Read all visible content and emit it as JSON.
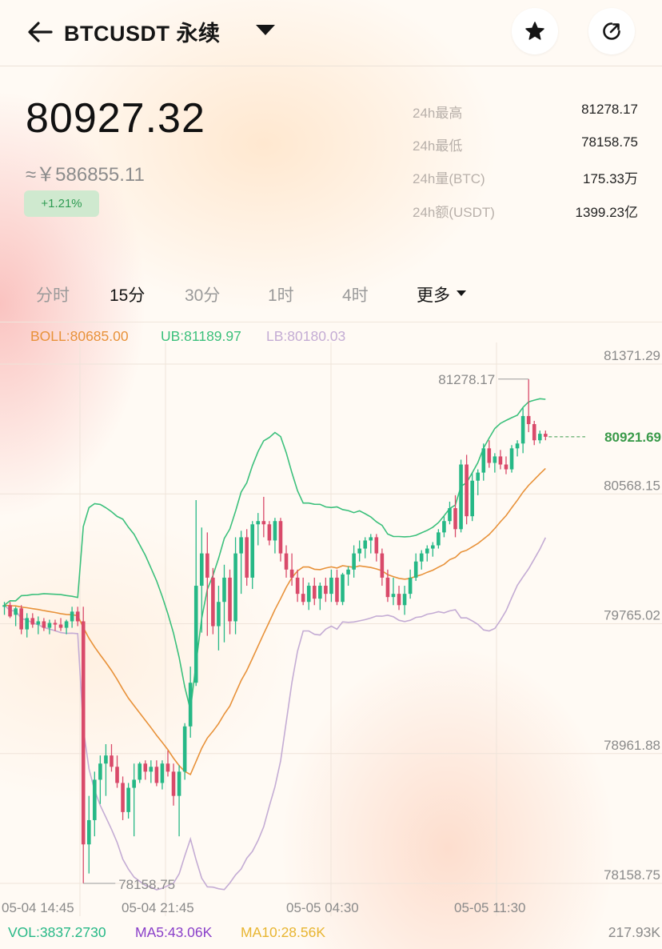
{
  "header": {
    "title": "BTCUSDT 永续",
    "icons": [
      "back-arrow-icon",
      "dropdown-caret-icon",
      "star-icon",
      "share-icon"
    ]
  },
  "ticker": {
    "last_price": "80927.32",
    "cny_price": "≈￥586855.11",
    "change_pct": "+1.21%"
  },
  "stats": [
    {
      "label": "24h最高",
      "value": "81278.17"
    },
    {
      "label": "24h最低",
      "value": "78158.75"
    },
    {
      "label": "24h量(BTC)",
      "value": "175.33万"
    },
    {
      "label": "24h额(USDT)",
      "value": "1399.23亿"
    }
  ],
  "tabs": [
    {
      "label": "分时",
      "active": false
    },
    {
      "label": "15分",
      "active": true
    },
    {
      "label": "30分",
      "active": false
    },
    {
      "label": "1时",
      "active": false
    },
    {
      "label": "4时",
      "active": false
    },
    {
      "label": "更多",
      "active": false
    }
  ],
  "boll": {
    "boll_label": "BOLL:80685.00",
    "ub_label": "UB:81189.97",
    "lb_label": "LB:80180.03"
  },
  "colors": {
    "up": "#26b886",
    "down": "#d94a6a",
    "boll": "#e8923a",
    "ub": "#3cc07c",
    "lb": "#c4acd4",
    "ma5": "#8a3fc9",
    "ma10": "#e8b530",
    "current_price": "#3a9a4a"
  },
  "chart_data": {
    "type": "candlestick",
    "interval": "15分",
    "y_axis_ticks": [
      "81371.29",
      "80568.15",
      "79765.02",
      "78961.88",
      "78158.75"
    ],
    "ylim": [
      78158.75,
      81371.29
    ],
    "x_axis_ticks": [
      "05-04 14:45",
      "05-04 21:45",
      "05-05 04:30",
      "05-05 11:30"
    ],
    "current_price_label": "80921.69",
    "high_marker": "81278.17",
    "low_marker": "78158.75",
    "candles": [
      {
        "o": 79870,
        "h": 79900,
        "l": 79820,
        "c": 79880
      },
      {
        "o": 79880,
        "h": 79900,
        "l": 79800,
        "c": 79810
      },
      {
        "o": 79820,
        "h": 79870,
        "l": 79750,
        "c": 79860
      },
      {
        "o": 79860,
        "h": 79880,
        "l": 79700,
        "c": 79730
      },
      {
        "o": 79730,
        "h": 79830,
        "l": 79680,
        "c": 79800
      },
      {
        "o": 79800,
        "h": 79830,
        "l": 79740,
        "c": 79760
      },
      {
        "o": 79760,
        "h": 79810,
        "l": 79700,
        "c": 79780
      },
      {
        "o": 79780,
        "h": 79800,
        "l": 79720,
        "c": 79740
      },
      {
        "o": 79740,
        "h": 79790,
        "l": 79700,
        "c": 79770
      },
      {
        "o": 79770,
        "h": 79790,
        "l": 79720,
        "c": 79760
      },
      {
        "o": 79760,
        "h": 79800,
        "l": 79720,
        "c": 79740
      },
      {
        "o": 79740,
        "h": 79790,
        "l": 79700,
        "c": 79780
      },
      {
        "o": 79780,
        "h": 79870,
        "l": 79740,
        "c": 79840
      },
      {
        "o": 79840,
        "h": 79870,
        "l": 79750,
        "c": 79780
      },
      {
        "o": 79780,
        "h": 79870,
        "l": 78160,
        "c": 78400
      },
      {
        "o": 78400,
        "h": 78700,
        "l": 78220,
        "c": 78550
      },
      {
        "o": 78550,
        "h": 78850,
        "l": 78450,
        "c": 78800
      },
      {
        "o": 78800,
        "h": 78950,
        "l": 78650,
        "c": 78900
      },
      {
        "o": 78900,
        "h": 79020,
        "l": 78700,
        "c": 78950
      },
      {
        "o": 78950,
        "h": 79020,
        "l": 78850,
        "c": 78880
      },
      {
        "o": 78880,
        "h": 78950,
        "l": 78750,
        "c": 78780
      },
      {
        "o": 78780,
        "h": 78820,
        "l": 78550,
        "c": 78600
      },
      {
        "o": 78600,
        "h": 78780,
        "l": 78560,
        "c": 78750
      },
      {
        "o": 78750,
        "h": 78900,
        "l": 78450,
        "c": 78800
      },
      {
        "o": 78800,
        "h": 78910,
        "l": 78780,
        "c": 78900
      },
      {
        "o": 78900,
        "h": 78920,
        "l": 78800,
        "c": 78850
      },
      {
        "o": 78850,
        "h": 78920,
        "l": 78780,
        "c": 78880
      },
      {
        "o": 78880,
        "h": 78920,
        "l": 78760,
        "c": 78780
      },
      {
        "o": 78780,
        "h": 78920,
        "l": 78740,
        "c": 78900
      },
      {
        "o": 78900,
        "h": 78980,
        "l": 78820,
        "c": 78850
      },
      {
        "o": 78850,
        "h": 78900,
        "l": 78640,
        "c": 78700
      },
      {
        "o": 78700,
        "h": 78890,
        "l": 78450,
        "c": 78850
      },
      {
        "o": 78850,
        "h": 79150,
        "l": 78800,
        "c": 79130
      },
      {
        "o": 79130,
        "h": 79500,
        "l": 79060,
        "c": 79400
      },
      {
        "o": 79400,
        "h": 80530,
        "l": 79380,
        "c": 80000
      },
      {
        "o": 80000,
        "h": 80360,
        "l": 79710,
        "c": 80200
      },
      {
        "o": 80200,
        "h": 80330,
        "l": 79690,
        "c": 80050
      },
      {
        "o": 80050,
        "h": 80110,
        "l": 79700,
        "c": 79750
      },
      {
        "o": 79750,
        "h": 80000,
        "l": 79600,
        "c": 79900
      },
      {
        "o": 79900,
        "h": 80130,
        "l": 79650,
        "c": 80050
      },
      {
        "o": 80050,
        "h": 80100,
        "l": 79700,
        "c": 79780
      },
      {
        "o": 79780,
        "h": 80300,
        "l": 79700,
        "c": 80200
      },
      {
        "o": 80200,
        "h": 80340,
        "l": 79950,
        "c": 80300
      },
      {
        "o": 80300,
        "h": 80350,
        "l": 80000,
        "c": 80050
      },
      {
        "o": 80050,
        "h": 80400,
        "l": 79980,
        "c": 80380
      },
      {
        "o": 80380,
        "h": 80450,
        "l": 80250,
        "c": 80400
      },
      {
        "o": 80400,
        "h": 80550,
        "l": 80300,
        "c": 80380
      },
      {
        "o": 80380,
        "h": 80400,
        "l": 80250,
        "c": 80280
      },
      {
        "o": 80280,
        "h": 80420,
        "l": 80200,
        "c": 80400
      },
      {
        "o": 80400,
        "h": 80420,
        "l": 80150,
        "c": 80200
      },
      {
        "o": 80200,
        "h": 80250,
        "l": 80050,
        "c": 80100
      },
      {
        "o": 80100,
        "h": 80200,
        "l": 80000,
        "c": 80050
      },
      {
        "o": 80050,
        "h": 80100,
        "l": 79900,
        "c": 79950
      },
      {
        "o": 79950,
        "h": 80050,
        "l": 79880,
        "c": 79900
      },
      {
        "o": 79900,
        "h": 80020,
        "l": 79850,
        "c": 80000
      },
      {
        "o": 80000,
        "h": 80050,
        "l": 79880,
        "c": 79920
      },
      {
        "o": 79920,
        "h": 80020,
        "l": 79850,
        "c": 80000
      },
      {
        "o": 80000,
        "h": 80050,
        "l": 79900,
        "c": 79950
      },
      {
        "o": 79950,
        "h": 80100,
        "l": 79900,
        "c": 80050
      },
      {
        "o": 80050,
        "h": 80100,
        "l": 79880,
        "c": 79900
      },
      {
        "o": 79900,
        "h": 80080,
        "l": 79880,
        "c": 80070
      },
      {
        "o": 80070,
        "h": 80120,
        "l": 80000,
        "c": 80100
      },
      {
        "o": 80100,
        "h": 80250,
        "l": 80050,
        "c": 80200
      },
      {
        "o": 80200,
        "h": 80280,
        "l": 80150,
        "c": 80230
      },
      {
        "o": 80230,
        "h": 80300,
        "l": 80170,
        "c": 80280
      },
      {
        "o": 80280,
        "h": 80320,
        "l": 80200,
        "c": 80300
      },
      {
        "o": 80300,
        "h": 80320,
        "l": 80150,
        "c": 80200
      },
      {
        "o": 80200,
        "h": 80230,
        "l": 80000,
        "c": 80050
      },
      {
        "o": 80050,
        "h": 80100,
        "l": 79900,
        "c": 79930
      },
      {
        "o": 79930,
        "h": 80050,
        "l": 79880,
        "c": 79950
      },
      {
        "o": 79950,
        "h": 80000,
        "l": 79850,
        "c": 79880
      },
      {
        "o": 79880,
        "h": 80000,
        "l": 79820,
        "c": 79950
      },
      {
        "o": 79950,
        "h": 80100,
        "l": 79920,
        "c": 80050
      },
      {
        "o": 80050,
        "h": 80200,
        "l": 80030,
        "c": 80150
      },
      {
        "o": 80150,
        "h": 80220,
        "l": 80100,
        "c": 80200
      },
      {
        "o": 80200,
        "h": 80250,
        "l": 80150,
        "c": 80230
      },
      {
        "o": 80230,
        "h": 80270,
        "l": 80180,
        "c": 80250
      },
      {
        "o": 80250,
        "h": 80350,
        "l": 80230,
        "c": 80330
      },
      {
        "o": 80330,
        "h": 80430,
        "l": 80300,
        "c": 80400
      },
      {
        "o": 80400,
        "h": 80520,
        "l": 80380,
        "c": 80480
      },
      {
        "o": 80480,
        "h": 80560,
        "l": 80300,
        "c": 80350
      },
      {
        "o": 80350,
        "h": 80780,
        "l": 80330,
        "c": 80750
      },
      {
        "o": 80750,
        "h": 80810,
        "l": 80380,
        "c": 80430
      },
      {
        "o": 80430,
        "h": 80700,
        "l": 80400,
        "c": 80650
      },
      {
        "o": 80650,
        "h": 80720,
        "l": 80560,
        "c": 80700
      },
      {
        "o": 80700,
        "h": 80880,
        "l": 80650,
        "c": 80850
      },
      {
        "o": 80850,
        "h": 80900,
        "l": 80730,
        "c": 80760
      },
      {
        "o": 80760,
        "h": 80820,
        "l": 80700,
        "c": 80800
      },
      {
        "o": 80800,
        "h": 80840,
        "l": 80720,
        "c": 80750
      },
      {
        "o": 80750,
        "h": 80800,
        "l": 80690,
        "c": 80720
      },
      {
        "o": 80720,
        "h": 80870,
        "l": 80700,
        "c": 80850
      },
      {
        "o": 80850,
        "h": 80900,
        "l": 80800,
        "c": 80880
      },
      {
        "o": 80880,
        "h": 81100,
        "l": 80820,
        "c": 81050
      },
      {
        "o": 81050,
        "h": 81278,
        "l": 80950,
        "c": 81000
      },
      {
        "o": 81000,
        "h": 81020,
        "l": 80870,
        "c": 80900
      },
      {
        "o": 80900,
        "h": 80960,
        "l": 80880,
        "c": 80940
      },
      {
        "o": 80940,
        "h": 80960,
        "l": 80900,
        "c": 80921.69
      }
    ],
    "volume": {
      "vol_label": "VOL:3837.2730",
      "ma5_label": "MA5:43.06K",
      "ma10_label": "MA10:28.56K",
      "max_label": "217.93K"
    }
  }
}
